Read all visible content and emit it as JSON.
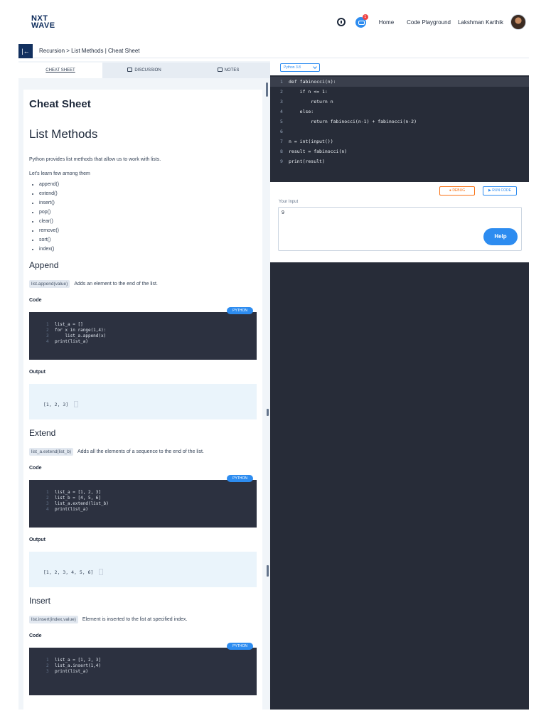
{
  "header": {
    "logo_top": "NXT",
    "logo_bottom": "WAVE",
    "nav": {
      "home": "Home",
      "playground": "Code Playground",
      "user": "Lakshman Karthik"
    },
    "notification_count": "1"
  },
  "breadcrumb": {
    "back_icon": "|←",
    "text": "Recursion > List Methods | Cheat Sheet"
  },
  "tabs": [
    {
      "label": "CHEAT SHEET"
    },
    {
      "label": "DISCUSSION"
    },
    {
      "label": "NOTES"
    }
  ],
  "sheet": {
    "title": "Cheat Sheet",
    "heading": "List Methods",
    "intro": "Python provides list methods that allow us to work with lists.",
    "intro2": "Let’s learn few among them",
    "methods": [
      "append()",
      "extend()",
      "insert()",
      "pop()",
      "clear()",
      "remove()",
      "sort()",
      "index()"
    ],
    "code_label": "Code",
    "output_label": "Output",
    "badge": "PYTHON",
    "sections": [
      {
        "title": "Append",
        "signature": "list.append(value)",
        "description": "Adds an element to the end of the list.",
        "code": [
          {
            "n": "1",
            "t": "list_a = []"
          },
          {
            "n": "2",
            "t": "for x in range(1,4):"
          },
          {
            "n": "3",
            "t": "    list_a.append(x)"
          },
          {
            "n": "4",
            "t": "print(list_a)"
          }
        ],
        "output": "[1, 2, 3]"
      },
      {
        "title": "Extend",
        "signature": "list_a.extend(list_b)",
        "description": "Adds all the elements of a sequence to the end of the list.",
        "code": [
          {
            "n": "1",
            "t": "list_a = [1, 2, 3]"
          },
          {
            "n": "2",
            "t": "list_b = [4, 5, 6]"
          },
          {
            "n": "3",
            "t": "list_a.extend(list_b)"
          },
          {
            "n": "4",
            "t": "print(list_a)"
          }
        ],
        "output": "[1, 2, 3, 4, 5, 6]"
      },
      {
        "title": "Insert",
        "signature": "list.insert(index,value)",
        "description": "Element is inserted to the list at specified index.",
        "code": [
          {
            "n": "1",
            "t": "list_a = [1, 2, 3]"
          },
          {
            "n": "2",
            "t": "list_a.insert(1,4)"
          },
          {
            "n": "3",
            "t": "print(list_a)"
          }
        ]
      }
    ]
  },
  "editor": {
    "language": "Python 3.8",
    "lines": [
      {
        "n": "1",
        "t": "def fabinocci(n):"
      },
      {
        "n": "2",
        "t": "    if n <= 1:"
      },
      {
        "n": "3",
        "t": "        return n"
      },
      {
        "n": "4",
        "t": "    else:"
      },
      {
        "n": "5",
        "t": "        return fabinocci(n-1) + fabinocci(n-2)"
      },
      {
        "n": "6",
        "t": ""
      },
      {
        "n": "7",
        "t": "n = int(input())"
      },
      {
        "n": "8",
        "t": "result = fabinocci(n)"
      },
      {
        "n": "9",
        "t": "print(result)"
      }
    ]
  },
  "io": {
    "debug_label": "DEBUG",
    "run_label": "RUN CODE",
    "input_label": "Your Input",
    "input_value": "9",
    "help_label": "Help"
  },
  "colors": {
    "primary": "#2d8cf0",
    "navy": "#12305f",
    "editor_bg": "#272c38",
    "debug": "#f97316"
  }
}
